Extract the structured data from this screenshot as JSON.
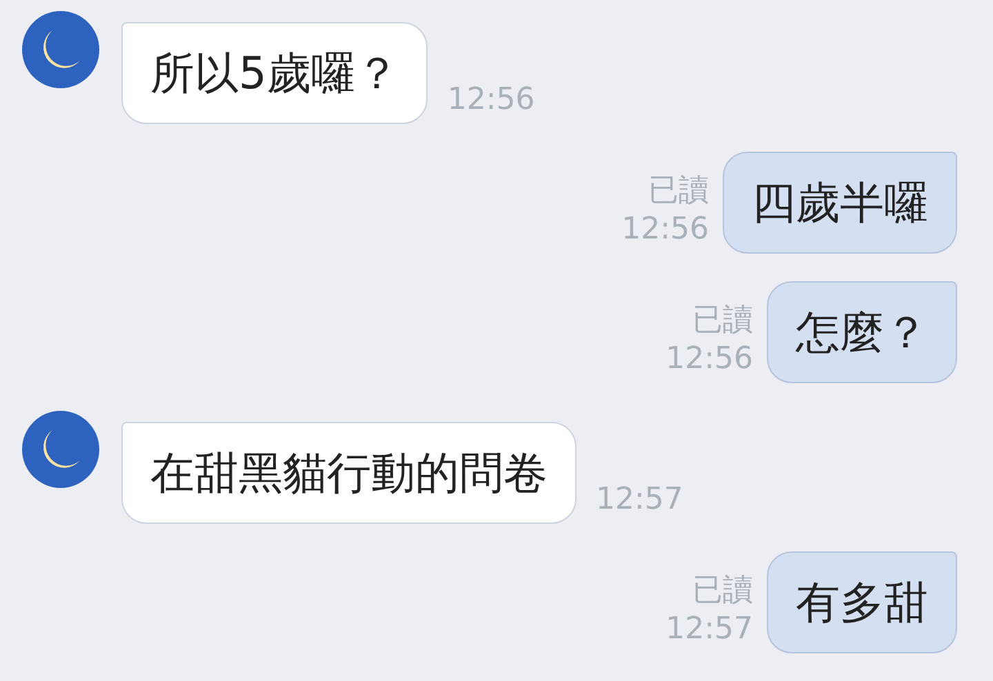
{
  "messages": [
    {
      "kind": "incoming",
      "text": "所以5歲囉？",
      "time": "12:56"
    },
    {
      "kind": "outgoing",
      "text": "四歲半囉",
      "read_label": "已讀",
      "time": "12:56"
    },
    {
      "kind": "outgoing",
      "text": "怎麼？",
      "read_label": "已讀",
      "time": "12:56"
    },
    {
      "kind": "incoming",
      "text": "在甜黑貓行動的問卷",
      "time": "12:57"
    },
    {
      "kind": "outgoing",
      "text": "有多甜",
      "read_label": "已讀",
      "time": "12:57"
    }
  ]
}
